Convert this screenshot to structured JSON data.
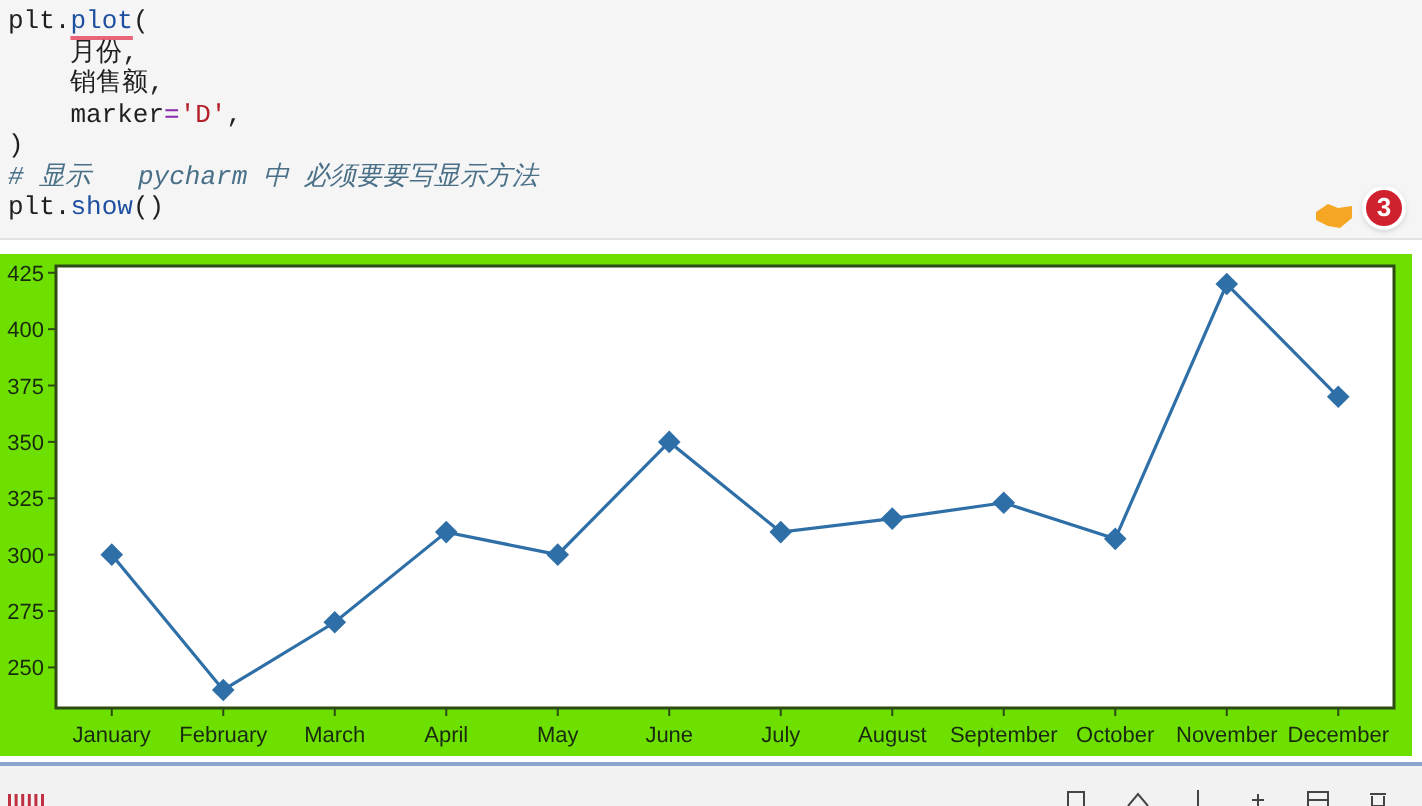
{
  "code_lines": [
    [
      {
        "text": "plt.",
        "kind": "plain"
      },
      {
        "text": "plot",
        "kind": "call_flagged"
      },
      {
        "text": "(",
        "kind": "plain"
      }
    ],
    [
      {
        "text": "    月份,",
        "kind": "plain"
      }
    ],
    [
      {
        "text": "    销售额,",
        "kind": "plain"
      }
    ],
    [
      {
        "text": "    marker",
        "kind": "plain"
      },
      {
        "text": "=",
        "kind": "keyword"
      },
      {
        "text": "'D'",
        "kind": "string"
      },
      {
        "text": ",",
        "kind": "plain"
      }
    ],
    [
      {
        "text": ")",
        "kind": "plain"
      }
    ],
    [
      {
        "text": "# 显示   pycharm 中 必须要要写显示方法",
        "kind": "comment"
      }
    ],
    [
      {
        "text": "plt.",
        "kind": "plain"
      },
      {
        "text": "show",
        "kind": "call"
      },
      {
        "text": "()",
        "kind": "plain"
      }
    ]
  ],
  "badge": {
    "count": "3"
  },
  "chart": {
    "chart_data": {
      "type": "line",
      "categories": [
        "January",
        "February",
        "March",
        "April",
        "May",
        "June",
        "July",
        "August",
        "September",
        "October",
        "November",
        "December"
      ],
      "series": [
        {
          "color": "#2f6fa8",
          "marker": "diamond",
          "values": [
            300,
            240,
            270,
            310,
            300,
            350,
            310,
            316,
            323,
            307,
            420,
            370
          ]
        }
      ],
      "ylim": [
        232,
        428
      ],
      "yticks": [
        250,
        275,
        300,
        325,
        350,
        375,
        400,
        425
      ]
    }
  }
}
